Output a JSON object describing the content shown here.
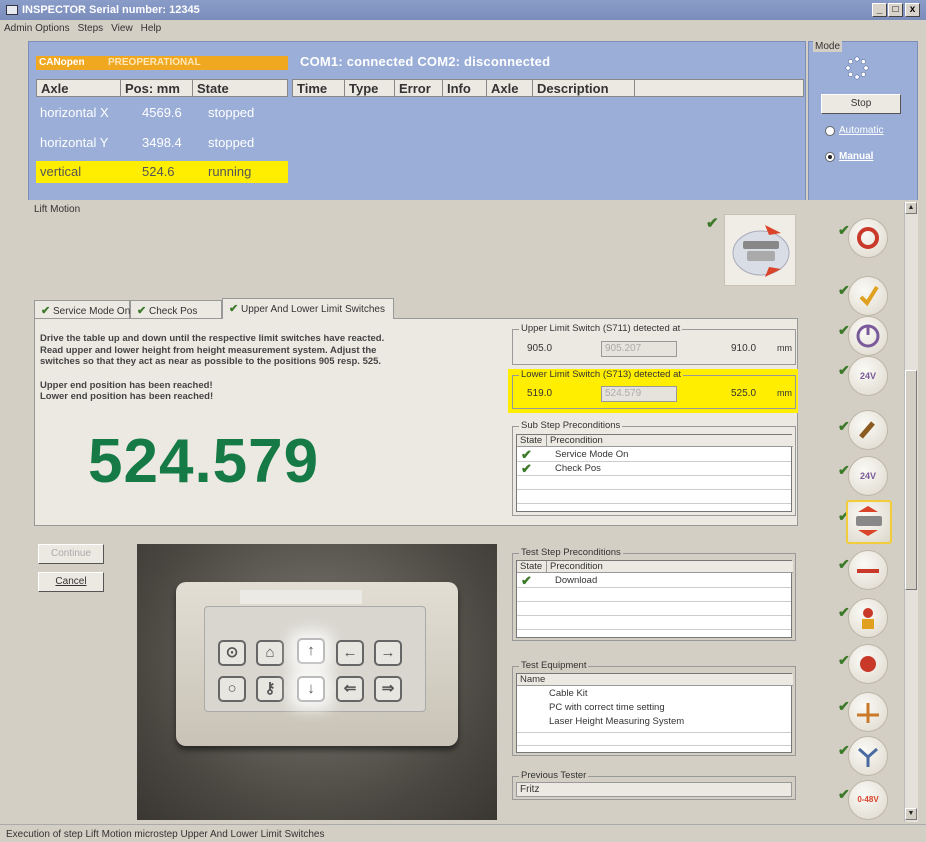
{
  "window": {
    "title": "INSPECTOR  Serial number: 12345",
    "buttons": [
      "_",
      "□",
      "x"
    ]
  },
  "menu": [
    "Admin Options",
    "Steps",
    "View",
    "Help"
  ],
  "status": {
    "bus": "CANopen",
    "bus_state": "PREOPERATIONAL",
    "com_status": "COM1: connected    COM2: disconnected",
    "axis_headers": [
      "Axle",
      "Pos: mm",
      "State"
    ],
    "axes": [
      {
        "name": "horizontal X",
        "pos": "4569.6",
        "state": "stopped"
      },
      {
        "name": "horizontal Y",
        "pos": "3498.4",
        "state": "stopped"
      },
      {
        "name": "vertical",
        "pos": "524.6",
        "state": "running"
      }
    ],
    "error_headers": [
      "Time",
      "Type",
      "Error",
      "Info",
      "Axle",
      "Description"
    ]
  },
  "mode": {
    "label": "Mode",
    "stop_label": "Stop",
    "automatic_label": "Automatic",
    "manual_label": "Manual",
    "selected": "Manual"
  },
  "step": {
    "title": "Lift Motion",
    "tabs": [
      "Service Mode On",
      "Check Pos",
      "Upper And Lower Limit Switches"
    ],
    "instructions": "Drive the table up and down until the respective limit switches have reacted. Read upper and lower height from height measurement system. Adjust the switches so that they act as near as possible to the positions 905 resp. 525.",
    "messages": [
      "Upper end position has been reached!",
      "Lower end position has been reached!"
    ],
    "big_value": "524.579",
    "upper": {
      "label": "Upper Limit Switch (S711) detected at",
      "min": "905.0",
      "value": "905.207",
      "max": "910.0",
      "unit": "mm"
    },
    "lower": {
      "label": "Lower Limit Switch (S713) detected at",
      "min": "519.0",
      "value": "524.579",
      "max": "525.0",
      "unit": "mm"
    },
    "substep": {
      "label": "Sub Step Preconditions",
      "headers": [
        "State",
        "Precondition"
      ],
      "rows": [
        "Service Mode On",
        "Check Pos"
      ]
    }
  },
  "actions": {
    "continue_label": "Continue",
    "cancel_label": "Cancel"
  },
  "test_preconditions": {
    "label": "Test Step Preconditions",
    "headers": [
      "State",
      "Precondition"
    ],
    "rows": [
      "Download"
    ]
  },
  "test_equipment": {
    "label": "Test Equipment",
    "header": "Name",
    "rows": [
      "Cable Kit",
      "PC with correct time setting",
      "Laser Height Measuring System"
    ]
  },
  "previous_tester": {
    "label": "Previous Tester",
    "value": "Fritz"
  },
  "sidebar_badges": [
    "24V",
    "24V",
    "0-48V"
  ],
  "statusbar": "Execution of step Lift Motion microstep Upper And Lower Limit Switches"
}
